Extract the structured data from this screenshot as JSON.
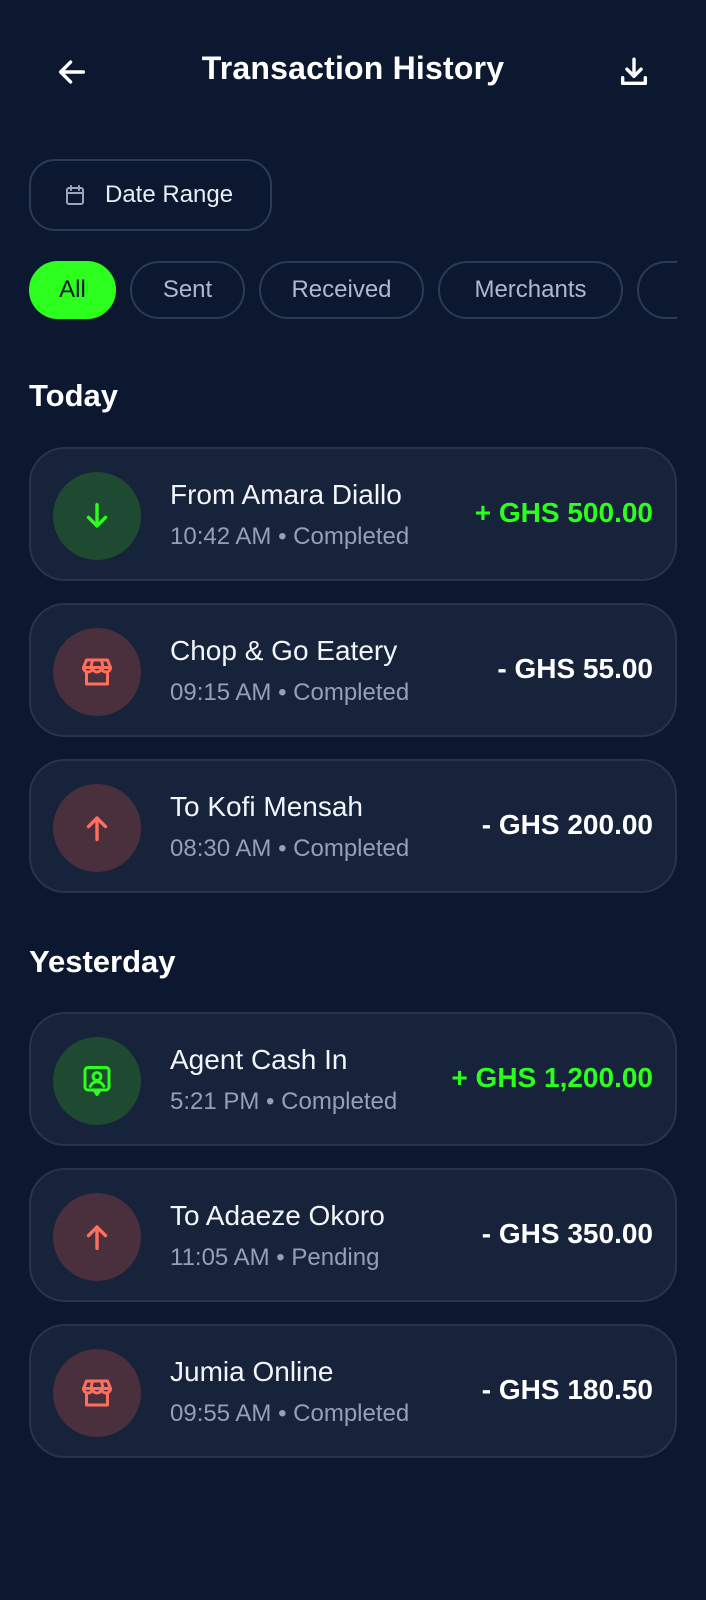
{
  "header": {
    "title": "Transaction History",
    "back_icon": "arrow-left-icon",
    "download_icon": "download-icon"
  },
  "date_filter": {
    "label": "Date Range",
    "icon": "calendar-icon"
  },
  "filters": [
    "All",
    "Sent",
    "Received",
    "Merchants"
  ],
  "active_filter": "All",
  "colors": {
    "background": "#0b1830",
    "accent_green": "#2cff1e",
    "negative_red": "#ff6f5e",
    "card": "#16233a"
  },
  "sections": [
    {
      "title": "Today",
      "transactions": [
        {
          "name": "From Amara Diallo",
          "time": "10:42 AM",
          "status": "Completed",
          "amount": "+ GHS 500.00",
          "icon": "arrow-down-icon"
        },
        {
          "name": "Chop & Go Eatery",
          "time": "09:15 AM",
          "status": "Completed",
          "amount": "- GHS 55.00",
          "icon": "store-icon"
        },
        {
          "name": "To Kofi Mensah",
          "time": "08:30 AM",
          "status": "Completed",
          "amount": "- GHS 200.00",
          "icon": "arrow-up-icon"
        }
      ]
    },
    {
      "title": "Yesterday",
      "transactions": [
        {
          "name": "Agent Cash In",
          "time": "5:21 PM",
          "status": "Completed",
          "amount": "+ GHS 1,200.00",
          "icon": "agent-icon"
        },
        {
          "name": "To Adaeze Okoro",
          "time": "11:05 AM",
          "status": "Pending",
          "amount": "- GHS 350.00",
          "icon": "arrow-up-icon"
        },
        {
          "name": "Jumia Online",
          "time": "09:55 AM",
          "status": "Completed",
          "amount": "- GHS 180.50",
          "icon": "store-icon"
        }
      ]
    }
  ]
}
